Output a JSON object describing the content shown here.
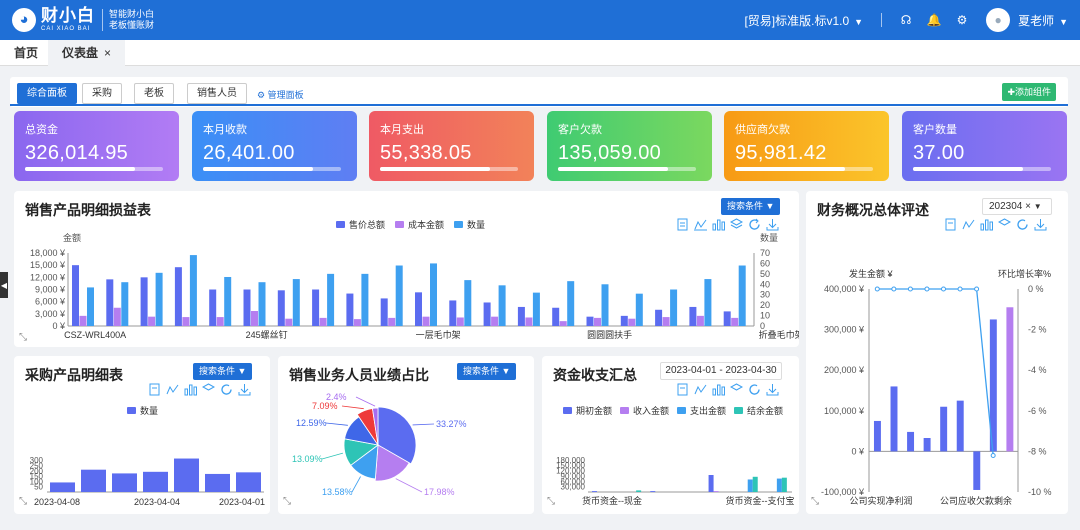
{
  "header": {
    "logo_cn": "财小白",
    "logo_en": "CAI XIAO BAI",
    "slogan1": "智能财小白",
    "slogan2": "老板懂账财",
    "edition": "[贸易]标准版.标v1.0",
    "user": "夏老师"
  },
  "tabs": [
    {
      "label": "首页"
    },
    {
      "label": "仪表盘",
      "close": "×"
    }
  ],
  "dash_tabs": [
    {
      "label": "综合面板"
    },
    {
      "label": "采购"
    },
    {
      "label": "老板"
    },
    {
      "label": "销售人员"
    }
  ],
  "manage_label": "管理面板",
  "add_label": "添加组件",
  "kpis": [
    {
      "label": "总资金",
      "value": "326,014.95",
      "color": "#9f68f0"
    },
    {
      "label": "本月收款",
      "value": "26,401.00",
      "color": "#3d8cf5"
    },
    {
      "label": "本月支出",
      "value": "55,338.05",
      "color": "#ef5f63"
    },
    {
      "label": "客户欠款",
      "value": "135,059.00",
      "color": "#4fce6a"
    },
    {
      "label": "供应商欠款",
      "value": "95,981.42",
      "color": "#f8a818"
    },
    {
      "label": "客户数量",
      "value": "37.00",
      "color": "#7b6ef2"
    }
  ],
  "search_label": "搜索条件",
  "panels": {
    "sales_profit": {
      "title": "销售产品明细损益表"
    },
    "purchase": {
      "title": "采购产品明细表"
    },
    "staff": {
      "title": "销售业务人员业绩占比"
    },
    "cashflow": {
      "title": "资金收支汇总",
      "date_range": "2023-04-01 - 2023-04-30"
    },
    "finance": {
      "title": "财务概况总体评述",
      "period": "202304"
    }
  },
  "colors": {
    "price": "#5b6cf0",
    "cost": "#b57ef0",
    "qty": "#3ea0f0",
    "end": "#2ec4b6",
    "line": "#3ea0f0"
  },
  "chart_data": [
    {
      "type": "bar",
      "title": "销售产品明细损益表",
      "series": [
        {
          "name": "售价总额",
          "values": [
            15000,
            11500,
            12000,
            14500,
            9000,
            9000,
            8800,
            9000,
            8000,
            6800,
            8300,
            6300,
            5800,
            4700,
            4500,
            2300,
            2500,
            4000,
            4700,
            3600
          ]
        },
        {
          "name": "成本金额",
          "values": [
            2500,
            4500,
            2300,
            2200,
            2200,
            3700,
            1800,
            2000,
            1700,
            2000,
            2300,
            2100,
            2300,
            2100,
            1200,
            2000,
            1800,
            2200,
            2500,
            2000
          ]
        },
        {
          "name": "数量",
          "values": [
            37,
            42,
            51,
            68,
            47,
            42,
            45,
            50,
            50,
            58,
            60,
            44,
            39,
            32,
            43,
            40,
            31,
            35,
            45,
            58
          ]
        }
      ],
      "tick_labels": [
        "CSZ-WRL400A",
        "245螺丝钉",
        "一层毛巾架",
        "圆圆圆扶手",
        "折叠毛巾架"
      ],
      "ylabel_left": "金额",
      "ylabel_right": "数量",
      "y_left": [
        "18,000 ¥",
        "15,000 ¥",
        "12,000 ¥",
        "9,000 ¥",
        "6,000 ¥",
        "3,000 ¥",
        "0 ¥"
      ],
      "y_right": [
        "70",
        "60",
        "50",
        "40",
        "30",
        "20",
        "10",
        "0"
      ]
    },
    {
      "type": "bar",
      "title": "采购产品明细表",
      "series": [
        {
          "name": "数量",
          "values": [
            90,
            210,
            175,
            190,
            315,
            170,
            185
          ]
        }
      ],
      "tick_labels": [
        "2023-04-08",
        "2023-04-04",
        "2023-04-01"
      ],
      "y_labels": [
        "300",
        "250",
        "200",
        "150",
        "100",
        "50"
      ]
    },
    {
      "type": "pie",
      "title": "销售业务人员业绩占比",
      "slices": [
        {
          "label": "33.27%",
          "value": 33.27,
          "color": "#5b6cf0"
        },
        {
          "label": "17.98%",
          "value": 17.98,
          "color": "#b57ef0"
        },
        {
          "label": "13.58%",
          "value": 13.58,
          "color": "#3ea0f0"
        },
        {
          "label": "13.09%",
          "value": 13.09,
          "color": "#2ec4b6"
        },
        {
          "label": "12.59%",
          "value": 12.59,
          "color": "#3f67e8"
        },
        {
          "label": "7.09%",
          "value": 7.09,
          "color": "#ee3a3a"
        },
        {
          "label": "2.4%",
          "value": 2.4,
          "color": "#a66cf0"
        }
      ]
    },
    {
      "type": "bar",
      "title": "资金收支汇总",
      "series": [
        {
          "name": "期初金额",
          "values": [
            5000,
            0,
            5000,
            0,
            95000,
            0,
            0
          ]
        },
        {
          "name": "收入金额",
          "values": [
            0,
            0,
            0,
            0,
            5000,
            0,
            0
          ]
        },
        {
          "name": "支出金额",
          "values": [
            0,
            0,
            0,
            0,
            0,
            70000,
            75000
          ]
        },
        {
          "name": "结余金额",
          "values": [
            0,
            9000,
            0,
            0,
            0,
            85000,
            80000
          ]
        }
      ],
      "tick_labels": [
        "货币资金--现金",
        "货币资金--支付宝"
      ],
      "y_labels": [
        "180,000",
        "150,000",
        "120,000",
        "90,000",
        "60,000",
        "30,000"
      ]
    },
    {
      "type": "bar",
      "title": "财务概况总体评述",
      "labels": {
        "left": "发生金额 ¥",
        "right": "环比增长率%"
      },
      "y_left": [
        "400,000 ¥",
        "300,000 ¥",
        "200,000 ¥",
        "100,000 ¥",
        "0 ¥",
        "-100,000 ¥"
      ],
      "y_right": [
        "0 %",
        "-2 %",
        "-4 %",
        "-6 %",
        "-8 %",
        "-10 %"
      ],
      "tick_labels": [
        "公司实现净利润",
        "公司应收欠款剩余"
      ],
      "series": [
        {
          "name": "发生金额",
          "values": [
            75000,
            160000,
            48000,
            33000,
            110000,
            125000,
            -95000,
            325000,
            355000
          ]
        },
        {
          "name": "环比增长率",
          "values": [
            0,
            0,
            0,
            0,
            0,
            0,
            0,
            -8.2
          ]
        }
      ]
    }
  ]
}
